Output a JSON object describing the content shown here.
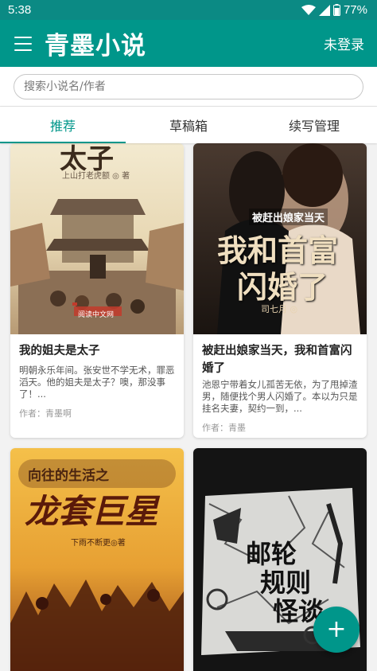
{
  "status_bar": {
    "time": "5:38",
    "battery": "77%"
  },
  "header": {
    "title": "青墨小说",
    "login_label": "未登录"
  },
  "search": {
    "placeholder": "搜索小说名/作者",
    "value": ""
  },
  "tabs": [
    {
      "label": "推荐",
      "active": true
    },
    {
      "label": "草稿箱",
      "active": false
    },
    {
      "label": "续写管理",
      "active": false
    }
  ],
  "books": [
    {
      "title": "我的姐夫是太子",
      "description": "明朝永乐年间。张安世不学无术，罪恶滔天。他的姐夫是太子？噢，那没事了！...",
      "author": "作者：青墨啊",
      "cover": {
        "title": "太子",
        "author": "上山打老虎额 ◎ 著",
        "badge": "阅读中文网"
      }
    },
    {
      "title": "被赶出娘家当天，我和首富闪婚了",
      "description": "池恩宁带着女儿孤苦无依，为了甩掉渣男，随便找个男人闪婚了。本以为只是挂名夫妻，契约一到，...",
      "author": "作者：青墨",
      "cover": {
        "subtitle": "被赶出娘家当天",
        "title_line1": "我和首富",
        "title_line2": "闪婚了",
        "author": "司七月 ◎"
      }
    },
    {
      "title": "",
      "description": "",
      "author": "",
      "cover": {
        "subtitle": "向往的生活之",
        "title": "龙套巨星",
        "author": "下雨不断更◎著"
      }
    },
    {
      "title": "",
      "description": "",
      "author": "",
      "cover": {
        "title_line1": "邮轮",
        "title_line2": "规则",
        "title_line3": "怪谈"
      }
    }
  ],
  "fab": {
    "label": "+"
  },
  "colors": {
    "primary": "#00968a",
    "status_bar": "#0b8a84"
  }
}
